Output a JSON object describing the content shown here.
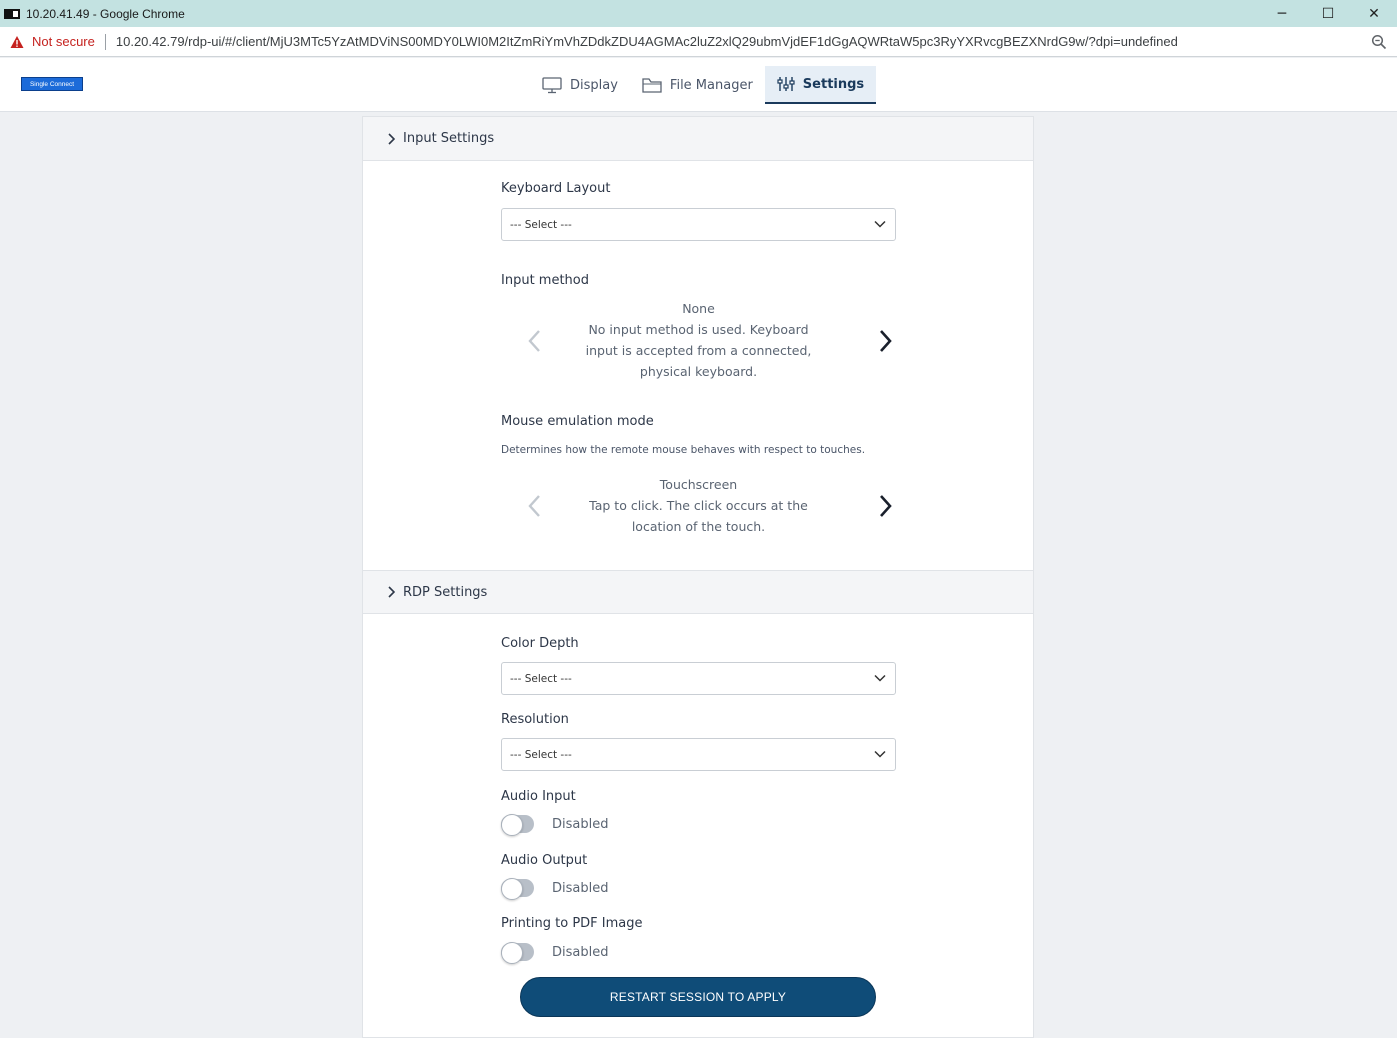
{
  "window": {
    "title": "10.20.41.49 - Google Chrome",
    "controls": {
      "minimize": "─",
      "maximize": "☐",
      "close": "✕"
    }
  },
  "address_bar": {
    "security_label": "Not secure",
    "url": "10.20.42.79/rdp-ui/#/client/MjU3MTc5YzAtMDViNS00MDY0LWI0M2ItZmRiYmVhZDdkZDU4AGMAc2luZ2xlQ29ubmVjdEF1dGgAQWRtaW5pc3RyYXRvcgBEZXNrdG9w/?dpi=undefined"
  },
  "header": {
    "logo_text": "Single Connect",
    "tabs": [
      {
        "label": "Display",
        "icon": "monitor-icon",
        "active": false
      },
      {
        "label": "File Manager",
        "icon": "folder-icon",
        "active": false
      },
      {
        "label": "Settings",
        "icon": "sliders-icon",
        "active": true
      }
    ]
  },
  "input_settings": {
    "title": "Input Settings",
    "keyboard_layout": {
      "label": "Keyboard Layout",
      "value": "--- Select ---"
    },
    "input_method": {
      "label": "Input method",
      "option_title": "None",
      "option_description": "No input method is used. Keyboard input is accepted from a connected, physical keyboard."
    },
    "mouse_emulation": {
      "label": "Mouse emulation mode",
      "help": "Determines how the remote mouse behaves with respect to touches.",
      "option_title": "Touchscreen",
      "option_description": "Tap to click. The click occurs at the location of the touch."
    }
  },
  "rdp_settings": {
    "title": "RDP Settings",
    "color_depth": {
      "label": "Color Depth",
      "value": "--- Select ---"
    },
    "resolution": {
      "label": "Resolution",
      "value": "--- Select ---"
    },
    "audio_input": {
      "label": "Audio Input",
      "state": "Disabled"
    },
    "audio_output": {
      "label": "Audio Output",
      "state": "Disabled"
    },
    "printing": {
      "label": "Printing to PDF Image",
      "state": "Disabled"
    },
    "apply_button": "RESTART SESSION TO APPLY"
  },
  "colors": {
    "accent": "#0f4c78",
    "title_bar": "#c3e2e1",
    "warning": "#c5221f"
  }
}
